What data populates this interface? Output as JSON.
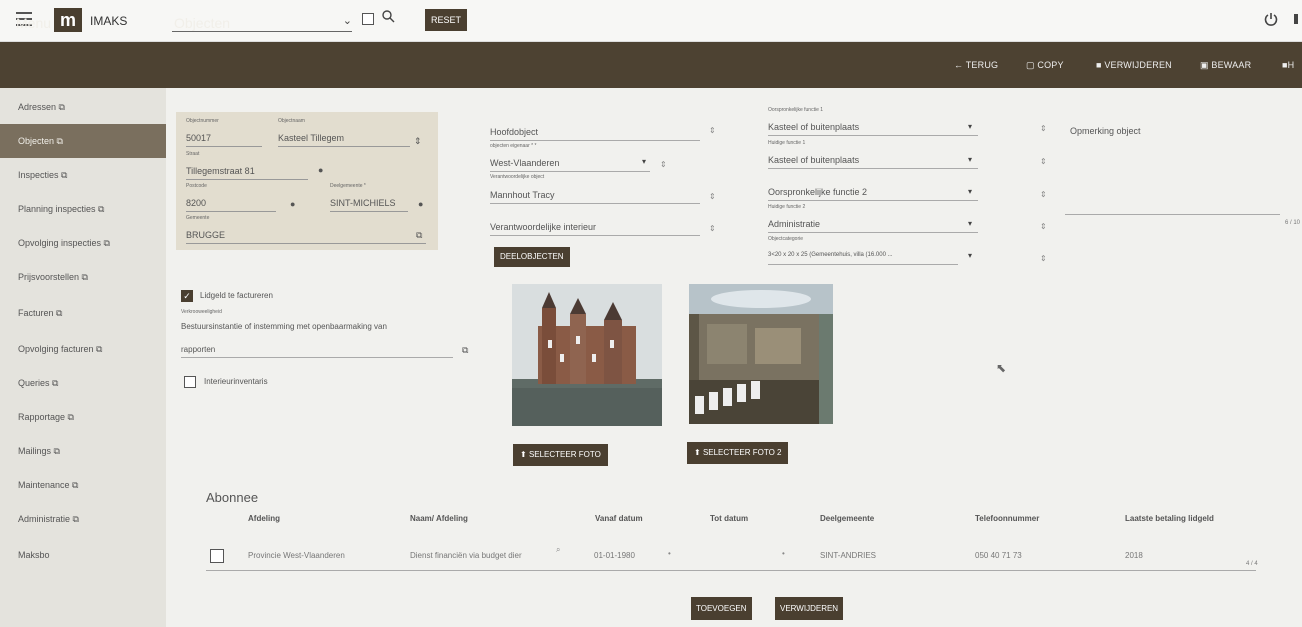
{
  "topbar": {
    "app_name": "IMAKS",
    "reset_label": "RESET",
    "logo_text": "m"
  },
  "header": {
    "menu_title": "Menu",
    "page_title": "Objecten",
    "actions": {
      "terug": "← TERUG",
      "copy": "COPY",
      "verwijderen": "VERWIJDEREN",
      "bewaar": "BEWAAR",
      "more": "H"
    }
  },
  "sidebar": {
    "items": [
      {
        "label": "Adressen ⧉"
      },
      {
        "label": "Objecten ⧉"
      },
      {
        "label": "Inspecties ⧉"
      },
      {
        "label": "Planning inspecties ⧉"
      },
      {
        "label": "Opvolging inspecties ⧉"
      },
      {
        "label": "Prijsvoorstellen ⧉"
      },
      {
        "label": "Facturen ⧉"
      },
      {
        "label": "Opvolging facturen ⧉"
      },
      {
        "label": "Queries ⧉"
      },
      {
        "label": "Rapportage ⧉"
      },
      {
        "label": "Mailings ⧉"
      },
      {
        "label": "Maintenance ⧉"
      },
      {
        "label": "Administratie ⧉"
      },
      {
        "label": "Maksbo"
      }
    ]
  },
  "address": {
    "objectnummer_label": "Objectnummer",
    "objectnummer": "50017",
    "objectnaam_label": "Objectnaam",
    "objectnaam": "Kasteel Tillegem",
    "straat_label": "Straat",
    "straat": "Tillegemstraat 81",
    "postcode_label": "Postcode",
    "postcode": "8200",
    "deelgemeente_label": "Deelgemeente *",
    "deelgemeente": "SINT-MICHIELS",
    "gemeente_label": "Gemeente",
    "gemeente": "BRUGGE"
  },
  "midform": {
    "hoofdobject": "Hoofdobject",
    "eigenaar_label": "objecten eigenaar * *",
    "eigenaar": "West-Vlaanderen",
    "verantw_label": "Verantwoordelijke object",
    "verantw": "Mannhout Tracy",
    "verantw_interieur": "Verantwoordelijke interieur",
    "deelobjecten_btn": "DEELOBJECTEN"
  },
  "functions": {
    "oorspr1_label": "Oorspronkelijke functie 1",
    "oorspr1": "Kasteel of buitenplaats",
    "huidig1_label": "Huidige functie 1",
    "huidig1": "Kasteel of buitenplaats",
    "oorspr2": "Oorspronkelijke functie 2",
    "huidig2_label": "Huidige functie 2",
    "huidig2": "Administratie",
    "categorie_label": "Objectcategorie",
    "categorie": "3<20 x 20 x 25 (Gemeentehuis, villa (16.000 ...",
    "opmerking": "Opmerking object"
  },
  "lidgeld": {
    "checkbox_label": "Lidgeld te factureren",
    "verkoop_label": "Verkrooweeligheid",
    "besluit_text": "Bestuursinstantie of instemming met openbaarmaking van",
    "rapporten": "rapporten",
    "interieur_label": "Interieurinventaris"
  },
  "photos": {
    "btn1": "SELECTEER FOTO",
    "btn2": "SELECTEER FOTO 2"
  },
  "abonnee": {
    "title": "Abonnee",
    "headers": [
      "Afdeling",
      "Naam/ Afdeling",
      "Vanaf datum",
      "Tot datum",
      "Deelgemeente",
      "Telefoonnummer",
      "Laatste betaling lidgeld"
    ],
    "row": {
      "afdeling": "Provincie West-Vlaanderen",
      "naam": "Dienst financiën via budget dier",
      "vanaf": "01-01-1980",
      "tot": "",
      "deelgemeente": "SINT-ANDRIES",
      "telefoon": "050 40 71 73",
      "laatste": "2018"
    },
    "pager": "4 / 4",
    "side_pager": "6 / 10"
  },
  "footer": {
    "toevoegen": "TOEVOEGEN",
    "verwijderen": "VERWIJDEREN"
  }
}
